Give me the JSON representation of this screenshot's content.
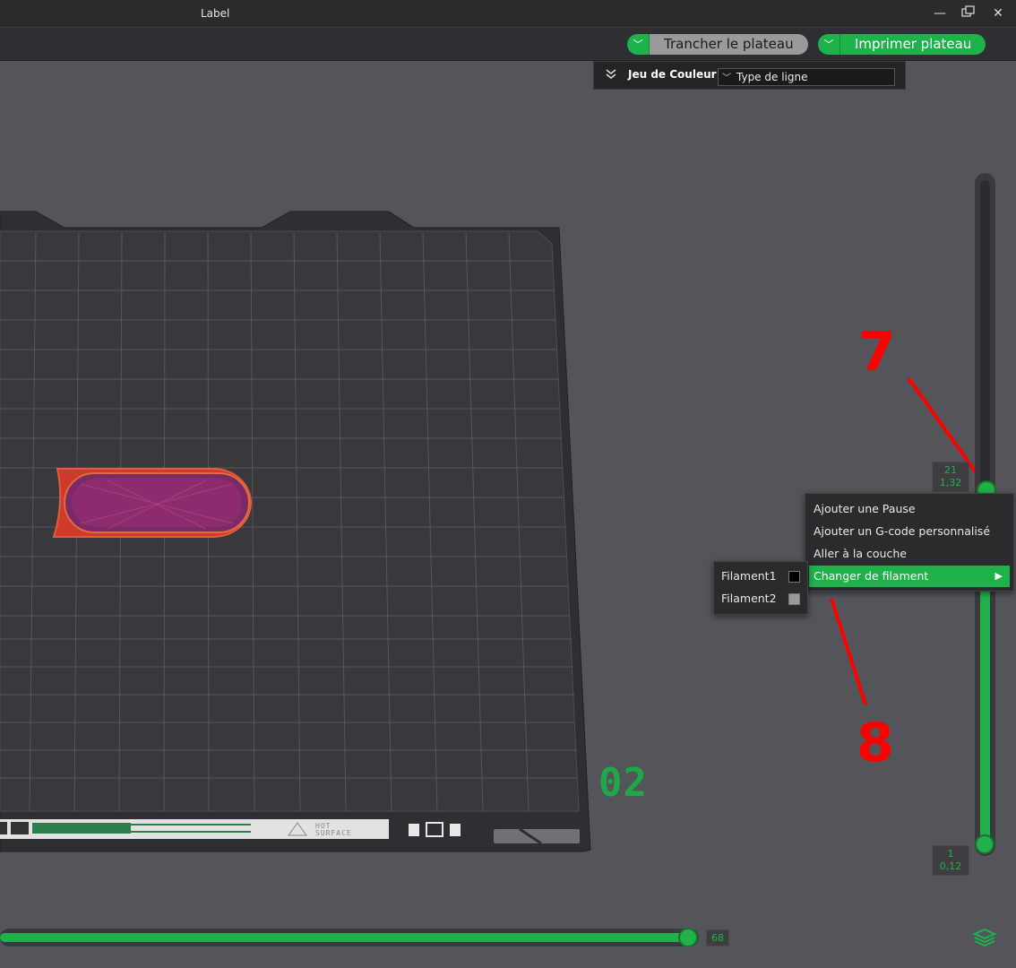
{
  "window": {
    "title": "Label"
  },
  "toolbar": {
    "slice_label": "Trancher le plateau",
    "print_label": "Imprimer plateau",
    "dropdown_glyph": "﹀"
  },
  "legend": {
    "label": "Jeu de Couleur",
    "select_value": "Type de ligne"
  },
  "bed": {
    "plate_number": "02",
    "hot_surface_text": "HOT\nSURFACE"
  },
  "layer_slider": {
    "top_layer": "21",
    "top_height": "1,32",
    "bottom_layer": "1",
    "bottom_height": "0,12"
  },
  "move_slider": {
    "value": "68"
  },
  "context_menu": {
    "items": [
      {
        "label": "Ajouter une Pause"
      },
      {
        "label": "Ajouter un G-code personnalisé"
      },
      {
        "label": "Aller à la couche"
      },
      {
        "label": "Changer de filament"
      }
    ]
  },
  "filament_submenu": {
    "items": [
      {
        "label": "Filament1",
        "color": "#000000"
      },
      {
        "label": "Filament2",
        "color": "#9a9a9a"
      }
    ]
  },
  "annotations": {
    "n7": "7",
    "n8": "8"
  },
  "colors": {
    "accent": "#1fb14a",
    "annotation": "#ff0000",
    "model": "#c0392b"
  },
  "icons": {
    "minimize": "minimize-icon",
    "restore": "restore-icon",
    "close": "close-icon",
    "layers": "layers-icon"
  }
}
